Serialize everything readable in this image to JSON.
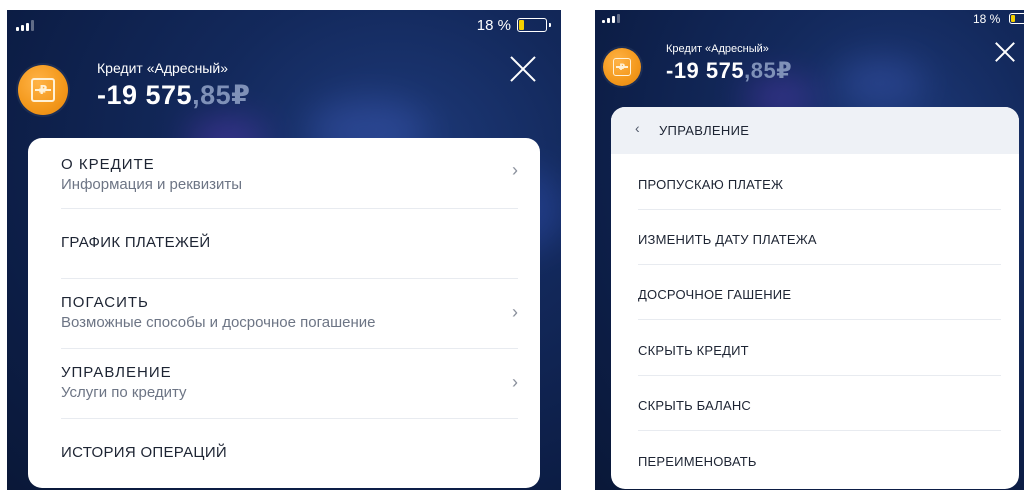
{
  "status": {
    "battery_percent": "18 %"
  },
  "credit": {
    "title": "Кредит «Адресный»",
    "amount_main": "-19 575",
    "amount_cents": ",85₽",
    "icon_glyph": "₽"
  },
  "colors": {
    "background": "#13295c",
    "accent_orange": "#f49a1e",
    "battery_fill": "#f5d000"
  },
  "main_menu": {
    "items": [
      {
        "title": "О КРЕДИТЕ",
        "subtitle": "Информация и реквизиты",
        "has_chevron": true
      },
      {
        "title": "ГРАФИК ПЛАТЕЖЕЙ",
        "subtitle": "",
        "has_chevron": false
      },
      {
        "title": "ПОГАСИТЬ",
        "subtitle": "Возможные способы и досрочное погашение",
        "has_chevron": true
      },
      {
        "title": "УПРАВЛЕНИЕ",
        "subtitle": "Услуги по кредиту",
        "has_chevron": true
      },
      {
        "title": "ИСТОРИЯ ОПЕРАЦИЙ",
        "subtitle": "",
        "has_chevron": false
      }
    ]
  },
  "management_menu": {
    "back_glyph": "‹",
    "header": "УПРАВЛЕНИЕ",
    "items": [
      "ПРОПУСКАЮ ПЛАТЕЖ",
      "ИЗМЕНИТЬ ДАТУ ПЛАТЕЖА",
      "ДОСРОЧНОЕ ГАШЕНИЕ",
      "СКРЫТЬ КРЕДИТ",
      "СКРЫТЬ БАЛАНС",
      "ПЕРЕИМЕНОВАТЬ"
    ]
  },
  "chevron_glyph": "›",
  "icons": {
    "close": "close-icon",
    "card": "ruble-card-icon",
    "signal": "signal-icon",
    "battery": "battery-icon"
  }
}
